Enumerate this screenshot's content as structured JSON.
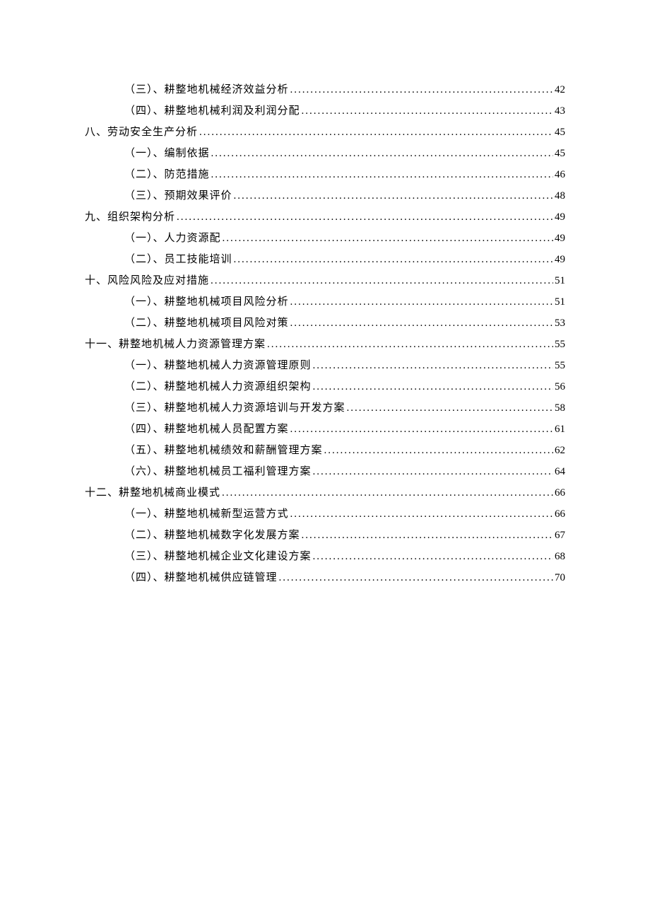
{
  "toc": [
    {
      "level": 2,
      "label": "（三）、耕整地机械经济效益分析",
      "page": "42"
    },
    {
      "level": 2,
      "label": "（四）、耕整地机械利润及利润分配",
      "page": "43"
    },
    {
      "level": 1,
      "label": "八、劳动安全生产分析",
      "page": "45"
    },
    {
      "level": 2,
      "label": "（一）、编制依据",
      "page": "45"
    },
    {
      "level": 2,
      "label": "（二）、防范措施",
      "page": "46"
    },
    {
      "level": 2,
      "label": "（三）、预期效果评价",
      "page": "48"
    },
    {
      "level": 1,
      "label": "九、组织架构分析",
      "page": "49"
    },
    {
      "level": 2,
      "label": "（一）、人力资源配",
      "page": "49"
    },
    {
      "level": 2,
      "label": "（二）、员工技能培训",
      "page": "49"
    },
    {
      "level": 1,
      "label": "十、风险风险及应对措施",
      "page": "51"
    },
    {
      "level": 2,
      "label": "（一）、耕整地机械项目风险分析",
      "page": "51"
    },
    {
      "level": 2,
      "label": "（二）、耕整地机械项目风险对策",
      "page": "53"
    },
    {
      "level": 1,
      "label": "十一、耕整地机械人力资源管理方案",
      "page": "55"
    },
    {
      "level": 2,
      "label": "（一）、耕整地机械人力资源管理原则",
      "page": "55"
    },
    {
      "level": 2,
      "label": "（二）、耕整地机械人力资源组织架构",
      "page": "56"
    },
    {
      "level": 2,
      "label": "（三）、耕整地机械人力资源培训与开发方案",
      "page": "58"
    },
    {
      "level": 2,
      "label": "（四）、耕整地机械人员配置方案",
      "page": "61"
    },
    {
      "level": 2,
      "label": "（五）、耕整地机械绩效和薪酬管理方案",
      "page": "62"
    },
    {
      "level": 2,
      "label": "（六）、耕整地机械员工福利管理方案",
      "page": "64"
    },
    {
      "level": 1,
      "label": "十二、耕整地机械商业模式",
      "page": "66"
    },
    {
      "level": 2,
      "label": "（一）、耕整地机械新型运营方式",
      "page": "66"
    },
    {
      "level": 2,
      "label": "（二）、耕整地机械数字化发展方案",
      "page": "67"
    },
    {
      "level": 2,
      "label": "（三）、耕整地机械企业文化建设方案",
      "page": "68"
    },
    {
      "level": 2,
      "label": "（四）、耕整地机械供应链管理",
      "page": "70"
    }
  ]
}
